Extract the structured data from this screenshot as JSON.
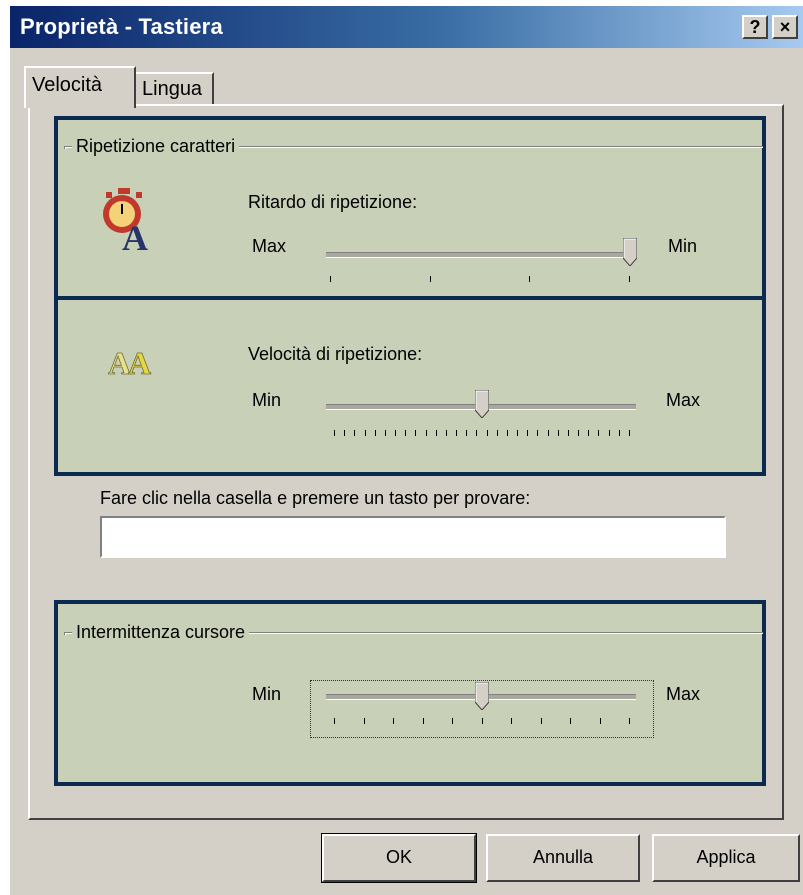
{
  "window": {
    "title": "Proprietà - Tastiera",
    "help_button": "?",
    "close_button": "×"
  },
  "tabs": [
    {
      "label": "Velocità",
      "active": true
    },
    {
      "label": "Lingua",
      "active": false
    }
  ],
  "repeat_group": {
    "legend": "Ripetizione caratteri",
    "delay": {
      "label": "Ritardo di ripetizione:",
      "left": "Max",
      "right": "Min",
      "ticks": 4,
      "value_fraction": 1.0
    },
    "rate": {
      "label": "Velocità di ripetizione:",
      "left": "Min",
      "right": "Max",
      "ticks": 30,
      "value_fraction": 0.5
    }
  },
  "test": {
    "label": "Fare clic nella casella e premere un tasto per provare:",
    "value": ""
  },
  "cursor_group": {
    "legend": "Intermittenza cursore",
    "blink": {
      "left": "Min",
      "right": "Max",
      "ticks": 11,
      "value_fraction": 0.5
    }
  },
  "buttons": {
    "ok": "OK",
    "cancel": "Annulla",
    "apply": "Applica"
  },
  "colors": {
    "highlight_bg": "#c9d0b8",
    "highlight_border": "#0c2a50",
    "title_start": "#0a246a"
  },
  "icons": {
    "delay": "stopwatch-letter-icon",
    "rate": "double-letter-icon"
  }
}
